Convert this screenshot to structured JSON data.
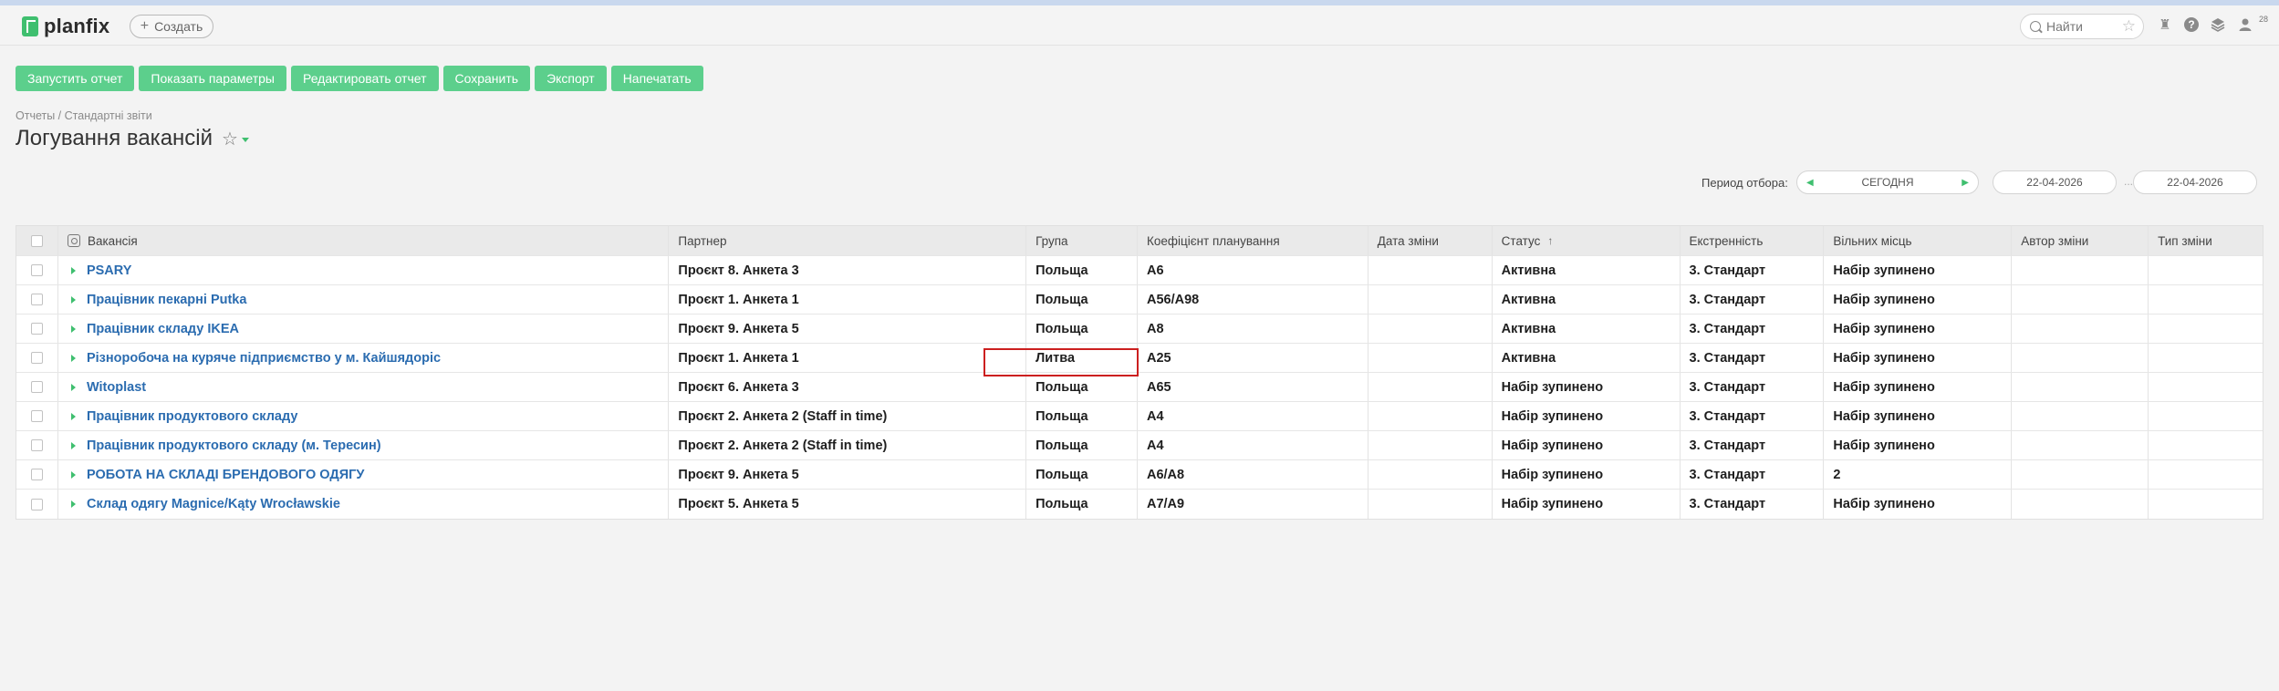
{
  "app": {
    "name": "planfix"
  },
  "header": {
    "create_label": "Создать",
    "search_placeholder": "Найти",
    "user_badge": "28"
  },
  "toolbar": {
    "buttons": [
      "Запустить отчет",
      "Показать параметры",
      "Редактировать отчет",
      "Сохранить",
      "Экспорт",
      "Напечатать"
    ]
  },
  "breadcrumb": "Отчеты / Стандартні звіти",
  "page": {
    "title": "Логування вакансій"
  },
  "filter": {
    "label": "Период отбора:",
    "period": "СЕГОДНЯ",
    "date_from": "22-04-2026",
    "date_to": "22-04-2026",
    "separator": "..."
  },
  "table": {
    "columns": [
      "Вакансія",
      "Партнер",
      "Група",
      "Коефіцієнт планування",
      "Дата зміни",
      "Статус",
      "Екстренність",
      "Вільних місць",
      "Автор зміни",
      "Тип зміни"
    ],
    "rows": [
      {
        "vacancy": "PSARY",
        "partner": "Проєкт 8. Анкета 3",
        "group": "Польща",
        "koef": "A6",
        "date": "",
        "status": "Активна",
        "urgency": "3. Стандарт",
        "free": "Набір зупинено",
        "author": "",
        "type": ""
      },
      {
        "vacancy": "Працівник пекарні Putka",
        "partner": "Проєкт 1. Анкета 1",
        "group": "Польща",
        "koef": "A56/A98",
        "date": "",
        "status": "Активна",
        "urgency": "3. Стандарт",
        "free": "Набір зупинено",
        "author": "",
        "type": ""
      },
      {
        "vacancy": "Працівник складу IKEA",
        "partner": "Проєкт 9. Анкета 5",
        "group": "Польща",
        "koef": "A8",
        "date": "",
        "status": "Активна",
        "urgency": "3. Стандарт",
        "free": "Набір зупинено",
        "author": "",
        "type": ""
      },
      {
        "vacancy": "Різноробоча на куряче підприємство у м. Кайшядоріс",
        "partner": "Проєкт 1. Анкета 1",
        "group": "Литва",
        "koef": "A25",
        "date": "",
        "status": "Активна",
        "urgency": "3. Стандарт",
        "free": "Набір зупинено",
        "author": "",
        "type": ""
      },
      {
        "vacancy": "Witoplast",
        "partner": "Проєкт 6. Анкета 3",
        "group": "Польща",
        "koef": "A65",
        "date": "",
        "status": "Набір зупинено",
        "urgency": "3. Стандарт",
        "free": "Набір зупинено",
        "author": "",
        "type": ""
      },
      {
        "vacancy": "Працівник продуктового складу",
        "partner": "Проєкт 2. Анкета 2 (Staff in time)",
        "group": "Польща",
        "koef": "A4",
        "date": "",
        "status": "Набір зупинено",
        "urgency": "3. Стандарт",
        "free": "Набір зупинено",
        "author": "",
        "type": ""
      },
      {
        "vacancy": "Працівник продуктового складу (м. Тересин)",
        "partner": "Проєкт 2. Анкета 2 (Staff in time)",
        "group": "Польща",
        "koef": "A4",
        "date": "",
        "status": "Набір зупинено",
        "urgency": "3. Стандарт",
        "free": "Набір зупинено",
        "author": "",
        "type": ""
      },
      {
        "vacancy": "РОБОТА НА СКЛАДІ БРЕНДОВОГО ОДЯГУ",
        "partner": "Проєкт 9. Анкета 5",
        "group": "Польща",
        "koef": "A6/A8",
        "date": "",
        "status": "Набір зупинено",
        "urgency": "3. Стандарт",
        "free": "2",
        "author": "",
        "type": ""
      },
      {
        "vacancy": "Склад одягу Magnice/Kąty Wrocławskie",
        "partner": "Проєкт 5. Анкета 5",
        "group": "Польща",
        "koef": "A7/A9",
        "date": "",
        "status": "Набір зупинено",
        "urgency": "3. Стандарт",
        "free": "Набір зупинено",
        "author": "",
        "type": ""
      }
    ]
  },
  "colors": {
    "accent": "#5ccf8c",
    "link": "#2b6cb0",
    "highlight": "#cc1f1f"
  },
  "icons": [
    "planfix-logo-icon",
    "plus-icon",
    "search-icon",
    "star-icon",
    "pin-icon",
    "help-icon",
    "layers-icon",
    "user-icon",
    "column-settings-icon",
    "expand-arrow-icon",
    "sort-up-icon"
  ]
}
